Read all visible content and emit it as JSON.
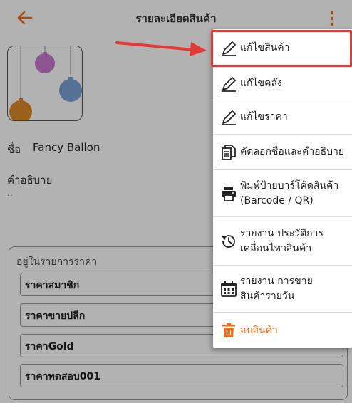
{
  "header": {
    "title": "รายละเอียดสินค้า"
  },
  "product": {
    "name_label": "ชื่อ",
    "name_value": "Fancy Ballon",
    "description_label": "คำอธิบาย",
    "description_value": ".."
  },
  "price_list": {
    "legend": "อยู่ในรายการราคา",
    "rows": [
      "ราคาสมาชิก",
      "ราคาขายปลีก",
      "ราคาGold",
      "ราคาทดสอบ001"
    ]
  },
  "menu": {
    "items": [
      {
        "label": "แก้ไขสินค้า",
        "icon": "pencil-icon"
      },
      {
        "label": "แก้ไขคลัง",
        "icon": "pencil-icon"
      },
      {
        "label": "แก้ไขราคา",
        "icon": "pencil-icon"
      },
      {
        "label": "คัดลอกชื่อและคำอธิบาย",
        "icon": "copy-document-icon"
      },
      {
        "label_line1": "พิมพ์ป้ายบาร์โค้ดสินค้า",
        "label_line2": "(Barcode / QR)",
        "icon": "printer-icon"
      },
      {
        "label_line1": "รายงาน ประวัติการ",
        "label_line2": "เคลื่อนไหวสินค้า",
        "icon": "history-icon"
      },
      {
        "label_line1": "รายงาน การขาย",
        "label_line2": "สินค้ารายวัน",
        "icon": "calendar-icon"
      },
      {
        "label": "ลบสินค้า",
        "icon": "trash-icon"
      }
    ]
  },
  "colors": {
    "accent": "#ef6c1a",
    "highlight_border": "#e53935",
    "overlay": "#4d4d4d"
  }
}
